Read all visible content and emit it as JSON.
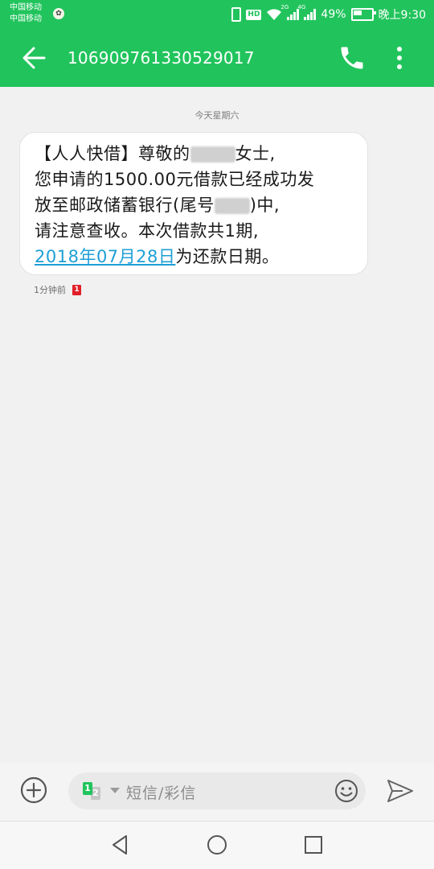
{
  "status_bar": {
    "carrier_1": "中国移动",
    "carrier_2": "中国移动",
    "carrier_badge_icon": "carrier-emblem-icon",
    "hd_label": "HD",
    "network_1": "2G",
    "network_2": "4G",
    "battery_percent": "49%",
    "time": "晚上9:30"
  },
  "app_bar": {
    "back_icon": "arrow-back-icon",
    "title": "106909761330529017",
    "call_icon": "phone-icon",
    "more_icon": "more-vertical-icon"
  },
  "conversation": {
    "date_separator": "今天星期六",
    "message": {
      "line1_prefix": "【人人快借】尊敬的",
      "line1_suffix": "女士,",
      "line2": "您申请的1500.00元借款已经成功发",
      "line3_prefix": "放至邮政储蓄银行(尾号",
      "line3_suffix": ")中,",
      "line4": "请注意查收。本次借款共1期,",
      "line5_link": "2018年07月28日",
      "line5_suffix": "为还款日期。"
    },
    "meta": {
      "time_ago": "1分钟前",
      "sim_badge": "1"
    }
  },
  "composer": {
    "add_icon": "add-circle-icon",
    "sim_1": "1",
    "sim_2": "2",
    "placeholder": "短信/彩信",
    "emoji_icon": "emoji-icon",
    "send_icon": "send-icon"
  },
  "nav_bar": {
    "back_icon": "nav-back-icon",
    "home_icon": "nav-home-icon",
    "recents_icon": "nav-recents-icon"
  },
  "colors": {
    "accent": "#21c45c",
    "link": "#1e9fd6",
    "sim_badge": "#e0202a"
  }
}
